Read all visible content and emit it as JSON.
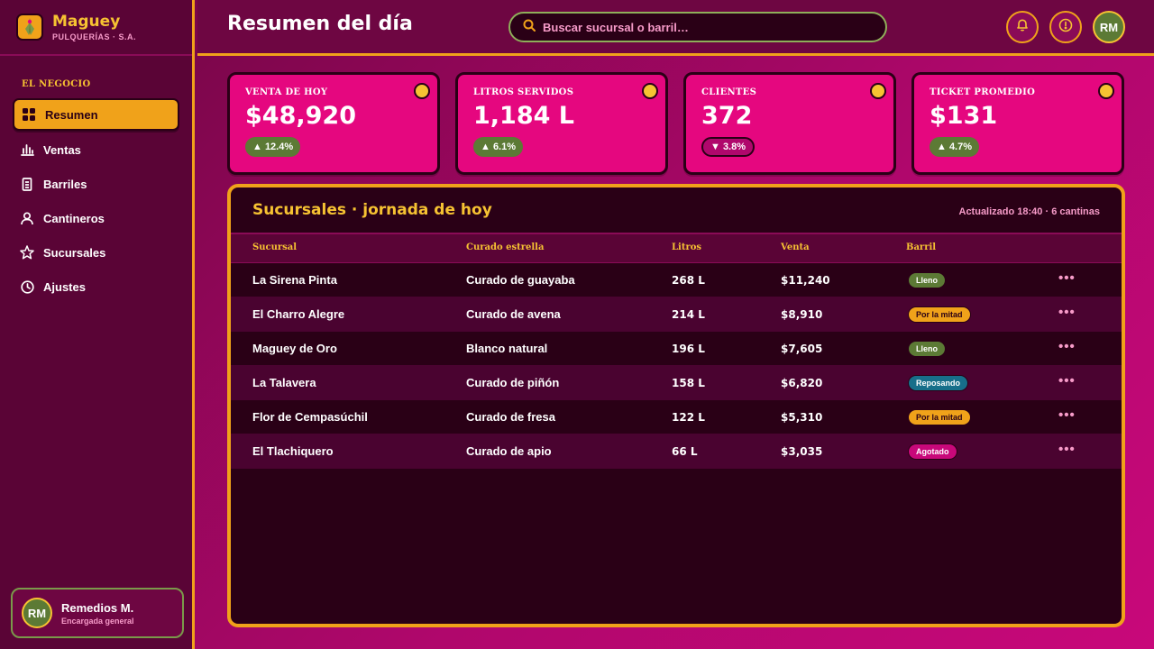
{
  "brand": {
    "name": "Maguey",
    "subtitle": "PULQUERÍAS · S.A."
  },
  "sidebar": {
    "section": "EL NEGOCIO",
    "items": [
      {
        "label": "Resumen",
        "icon": "grid-icon",
        "active": true
      },
      {
        "label": "Ventas",
        "icon": "bar-chart-icon"
      },
      {
        "label": "Barriles",
        "icon": "barrel-icon"
      },
      {
        "label": "Cantineros",
        "icon": "user-icon"
      },
      {
        "label": "Sucursales",
        "icon": "star-icon"
      },
      {
        "label": "Ajustes",
        "icon": "clock-icon"
      }
    ]
  },
  "user": {
    "initials": "RM",
    "name": "Remedios M.",
    "role": "Encargada general"
  },
  "header": {
    "title": "Resumen del día",
    "search_placeholder": "Buscar sucursal o barril…",
    "avatar_initials": "RM"
  },
  "kpis": [
    {
      "label": "VENTA DE HOY",
      "value": "$48,920",
      "delta": "▲ 12.4%",
      "direction": "up"
    },
    {
      "label": "LITROS SERVIDOS",
      "value": "1,184 L",
      "delta": "▲ 6.1%",
      "direction": "up"
    },
    {
      "label": "CLIENTES",
      "value": "372",
      "delta": "▼ 3.8%",
      "direction": "down"
    },
    {
      "label": "TICKET PROMEDIO",
      "value": "$131",
      "delta": "▲ 4.7%",
      "direction": "up"
    }
  ],
  "table": {
    "title": "Sucursales · jornada de hoy",
    "meta": "Actualizado 18:40 · 6 cantinas",
    "columns": [
      "Sucursal",
      "Curado estrella",
      "Litros",
      "Venta",
      "Barril"
    ],
    "rows": [
      {
        "sucursal": "La Sirena Pinta",
        "curado": "Curado de guayaba",
        "litros": "268 L",
        "venta": "$11,240",
        "barril": "Lleno",
        "status": "lleno"
      },
      {
        "sucursal": "El Charro Alegre",
        "curado": "Curado de avena",
        "litros": "214 L",
        "venta": "$8,910",
        "barril": "Por la mitad",
        "status": "mitad"
      },
      {
        "sucursal": "Maguey de Oro",
        "curado": "Blanco natural",
        "litros": "196 L",
        "venta": "$7,605",
        "barril": "Lleno",
        "status": "lleno"
      },
      {
        "sucursal": "La Talavera",
        "curado": "Curado de piñón",
        "litros": "158 L",
        "venta": "$6,820",
        "barril": "Reposando",
        "status": "reposando"
      },
      {
        "sucursal": "Flor de Cempasúchil",
        "curado": "Curado de fresa",
        "litros": "122 L",
        "venta": "$5,310",
        "barril": "Por la mitad",
        "status": "mitad"
      },
      {
        "sucursal": "El Tlachiquero",
        "curado": "Curado de apio",
        "litros": "66 L",
        "venta": "$3,035",
        "barril": "Agotado",
        "status": "agotado"
      }
    ],
    "row_action": "•••"
  },
  "status_colors": {
    "lleno": {
      "bg": "#5c7a35",
      "fg": "#ffffff"
    },
    "mitad": {
      "bg": "#f0a21a",
      "fg": "#2a0016"
    },
    "reposando": {
      "bg": "#176f8a",
      "fg": "#ffffff"
    },
    "agotado": {
      "bg": "#c8087a",
      "fg": "#ffffff"
    }
  }
}
